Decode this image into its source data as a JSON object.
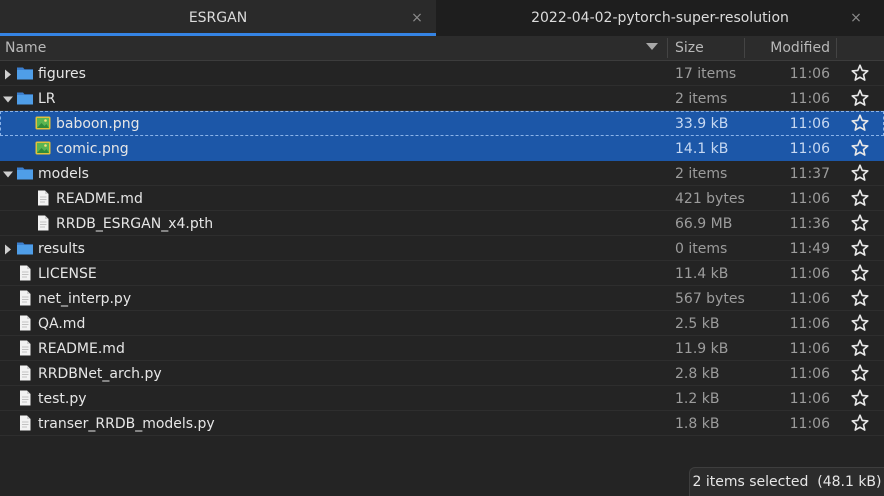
{
  "tabs": [
    {
      "title": "ESRGAN",
      "active": true
    },
    {
      "title": "2022-04-02-pytorch-super-resolution",
      "active": false
    }
  ],
  "close_glyph": "×",
  "columns": {
    "name": "Name",
    "size": "Size",
    "modified": "Modified"
  },
  "rows": [
    {
      "name": "figures",
      "size": "17 items",
      "modified": "11:06",
      "icon": "folder-icon",
      "level": 0,
      "expander": "collapsed",
      "selected": false
    },
    {
      "name": "LR",
      "size": "2 items",
      "modified": "11:06",
      "icon": "folder-icon",
      "level": 0,
      "expander": "expanded",
      "selected": false
    },
    {
      "name": "baboon.png",
      "size": "33.9 kB",
      "modified": "11:06",
      "icon": "image-file-icon",
      "level": 1,
      "expander": "none",
      "selected": true
    },
    {
      "name": "comic.png",
      "size": "14.1 kB",
      "modified": "11:06",
      "icon": "image-file-icon",
      "level": 1,
      "expander": "none",
      "selected": true
    },
    {
      "name": "models",
      "size": "2 items",
      "modified": "11:37",
      "icon": "folder-icon",
      "level": 0,
      "expander": "expanded",
      "selected": false
    },
    {
      "name": "README.md",
      "size": "421 bytes",
      "modified": "11:06",
      "icon": "text-file-icon",
      "level": 1,
      "expander": "none",
      "selected": false
    },
    {
      "name": "RRDB_ESRGAN_x4.pth",
      "size": "66.9 MB",
      "modified": "11:36",
      "icon": "text-file-icon",
      "level": 1,
      "expander": "none",
      "selected": false
    },
    {
      "name": "results",
      "size": "0 items",
      "modified": "11:49",
      "icon": "folder-icon",
      "level": 0,
      "expander": "collapsed",
      "selected": false
    },
    {
      "name": "LICENSE",
      "size": "11.4 kB",
      "modified": "11:06",
      "icon": "text-file-icon",
      "level": 0,
      "expander": "none",
      "selected": false
    },
    {
      "name": "net_interp.py",
      "size": "567 bytes",
      "modified": "11:06",
      "icon": "text-file-icon",
      "level": 0,
      "expander": "none",
      "selected": false
    },
    {
      "name": "QA.md",
      "size": "2.5 kB",
      "modified": "11:06",
      "icon": "text-file-icon",
      "level": 0,
      "expander": "none",
      "selected": false
    },
    {
      "name": "README.md",
      "size": "11.9 kB",
      "modified": "11:06",
      "icon": "text-file-icon",
      "level": 0,
      "expander": "none",
      "selected": false
    },
    {
      "name": "RRDBNet_arch.py",
      "size": "2.8 kB",
      "modified": "11:06",
      "icon": "text-file-icon",
      "level": 0,
      "expander": "none",
      "selected": false
    },
    {
      "name": "test.py",
      "size": "1.2 kB",
      "modified": "11:06",
      "icon": "text-file-icon",
      "level": 0,
      "expander": "none",
      "selected": false
    },
    {
      "name": "transer_RRDB_models.py",
      "size": "1.8 kB",
      "modified": "11:06",
      "icon": "text-file-icon",
      "level": 0,
      "expander": "none",
      "selected": false
    }
  ],
  "status": "2 items selected  (48.1 kB)",
  "colors": {
    "accent": "#3584e4",
    "selection": "#1c57a8",
    "folder": "#4f9ee8"
  }
}
